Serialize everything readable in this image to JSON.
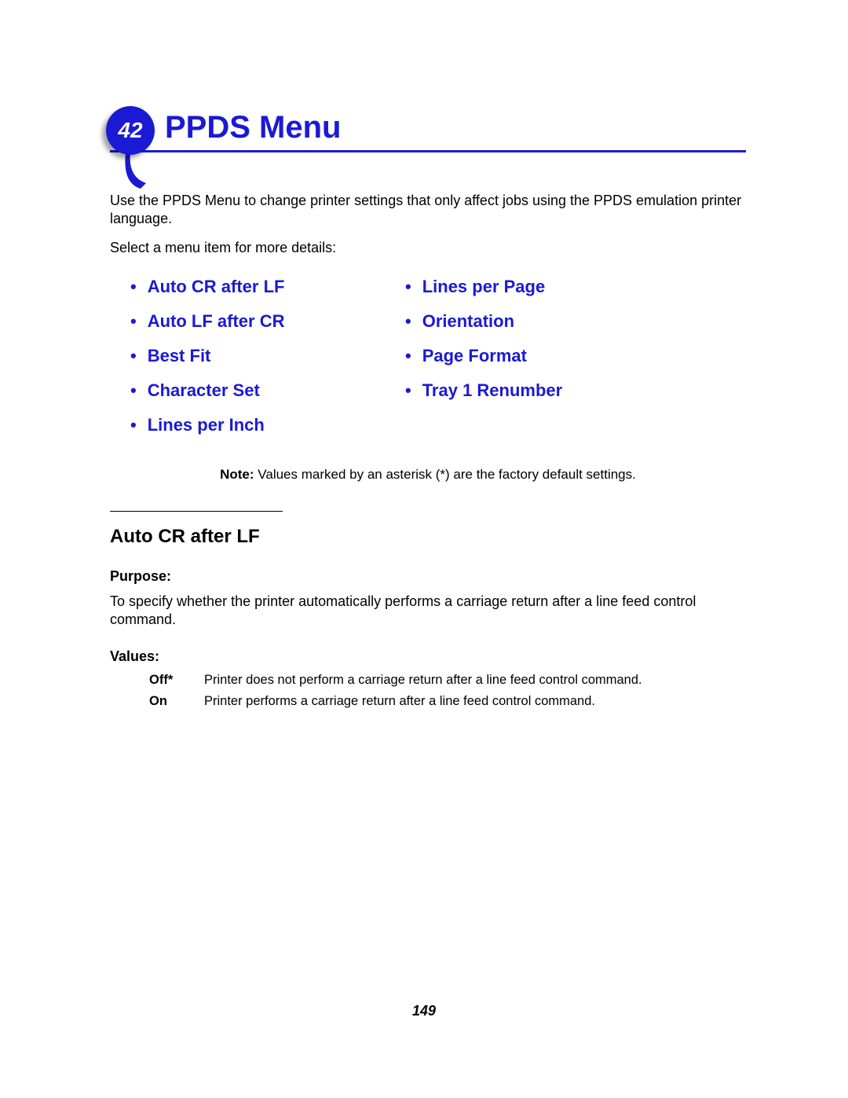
{
  "header": {
    "chapter_number": "42",
    "title": "PPDS Menu"
  },
  "intro": "Use the PPDS Menu to change printer settings that only affect jobs using the PPDS emulation printer language.",
  "select_prompt": "Select a menu item for more details:",
  "menu_left": [
    "Auto CR after LF",
    "Auto LF after CR",
    "Best Fit",
    "Character Set",
    "Lines per Inch"
  ],
  "menu_right": [
    "Lines per Page",
    "Orientation",
    "Page Format",
    "Tray 1 Renumber"
  ],
  "note_label": "Note:",
  "note_text": " Values marked by an asterisk (*) are the factory default settings.",
  "section": {
    "heading": "Auto CR after LF",
    "purpose_label": "Purpose:",
    "purpose_text": "To specify whether the printer automatically performs a carriage return after a line feed control command.",
    "values_label": "Values:",
    "values": [
      {
        "label": "Off*",
        "desc": "Printer does not perform a carriage return after a line feed control command."
      },
      {
        "label": "On",
        "desc": "Printer performs a carriage return after a line feed control command."
      }
    ]
  },
  "page_number": "149"
}
